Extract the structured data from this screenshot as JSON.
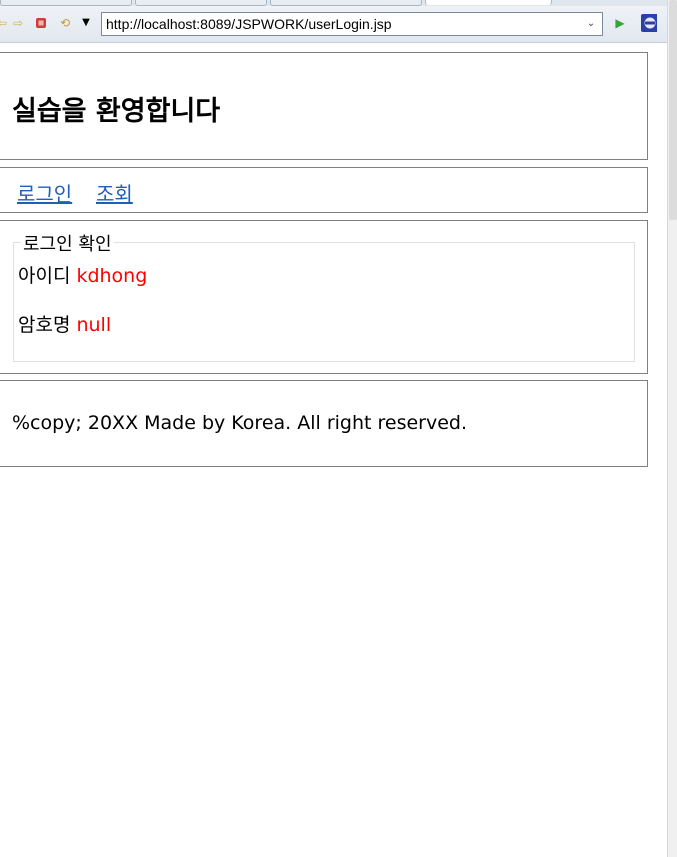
{
  "browser": {
    "url": "http://localhost:8089/JSPWORK/userLogin.jsp",
    "icons": [
      "back-arrow-icon",
      "forward-arrow-icon",
      "stop-icon",
      "refresh-icon",
      "menu-dropdown-icon",
      "url-dropdown-icon",
      "go-icon",
      "eclipse-icon"
    ]
  },
  "header": {
    "title": "실습을 환영합니다"
  },
  "nav": {
    "login_label": "로그인",
    "search_label": "조회"
  },
  "main": {
    "legend": "로그인 확인",
    "id_label": "아이디",
    "id_value": "kdhong",
    "password_label": "암호명",
    "password_value": "null"
  },
  "footer": {
    "text": "%copy; 20XX Made by Korea. All right reserved."
  },
  "colors": {
    "link": "#1f5fb4",
    "value": "#ff0000",
    "border": "#808080"
  }
}
